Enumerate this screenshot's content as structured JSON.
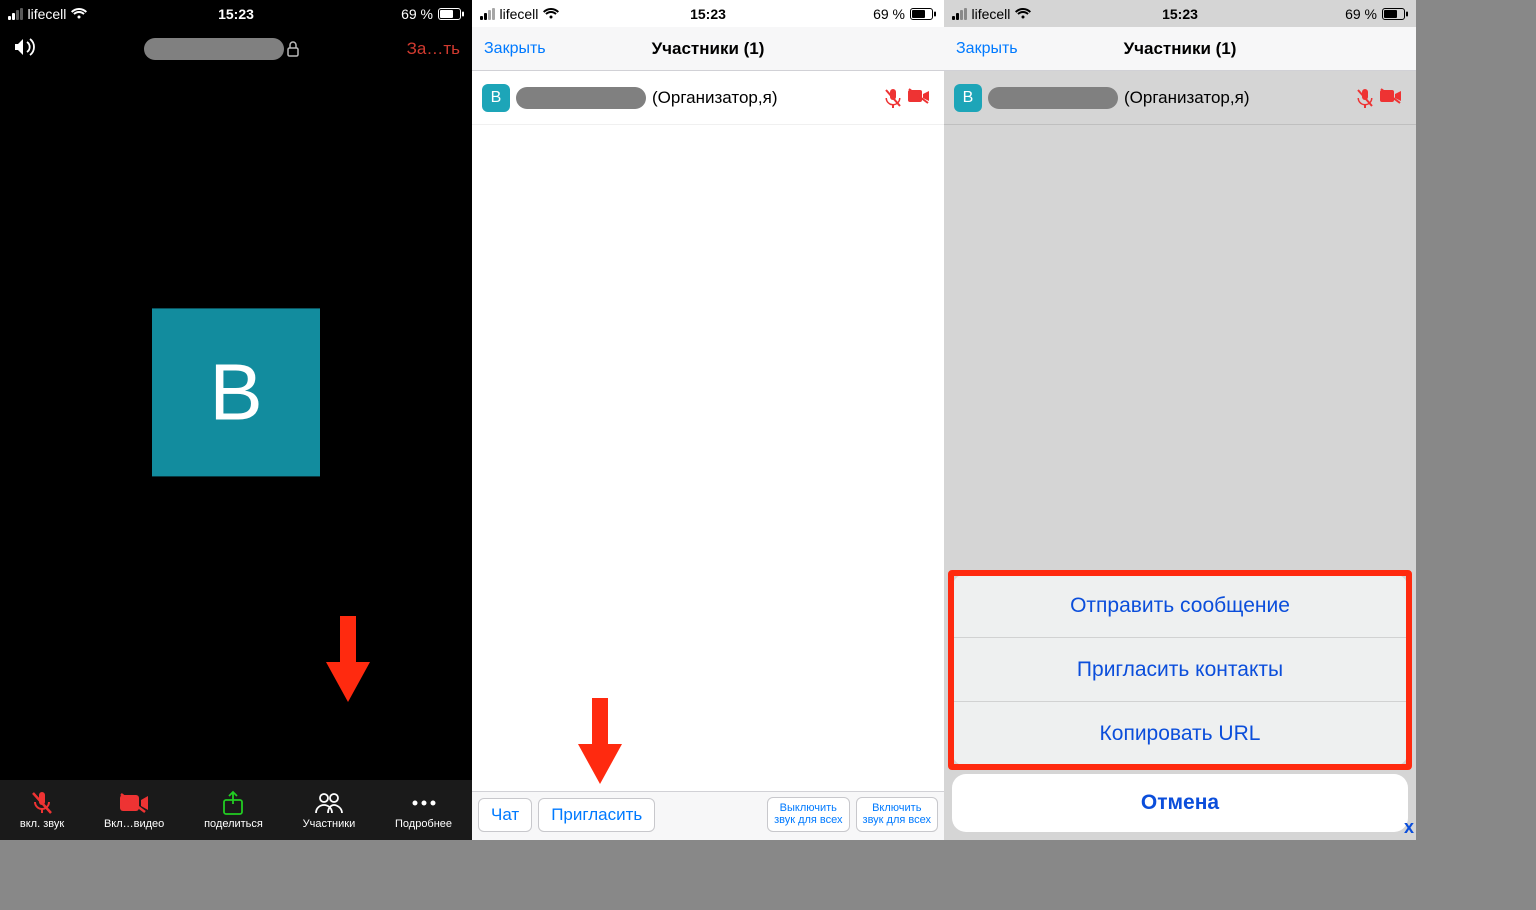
{
  "status": {
    "carrier": "lifecell",
    "time": "15:23",
    "battery": "69 %"
  },
  "screen1": {
    "end_label": "За…ть",
    "avatar_letter": "В",
    "toolbar": {
      "audio": "вкл. звук",
      "video": "Вкл…видео",
      "share": "поделиться",
      "participants": "Участники",
      "more": "Подробнее"
    }
  },
  "screen2": {
    "close": "Закрыть",
    "title": "Участники (1)",
    "participant": {
      "initial": "В",
      "role": "(Организатор,я)"
    },
    "bottom": {
      "chat": "Чат",
      "invite": "Пригласить",
      "mute_all": "Выключить\nзвук для всех",
      "unmute_all": "Включить\nзвук для всех"
    }
  },
  "screen3": {
    "close": "Закрыть",
    "title": "Участники (1)",
    "participant": {
      "initial": "В",
      "role": "(Организатор,я)"
    },
    "sheet": {
      "send_message": "Отправить сообщение",
      "invite_contacts": "Пригласить контакты",
      "copy_url": "Копировать URL",
      "cancel": "Отмена"
    }
  }
}
